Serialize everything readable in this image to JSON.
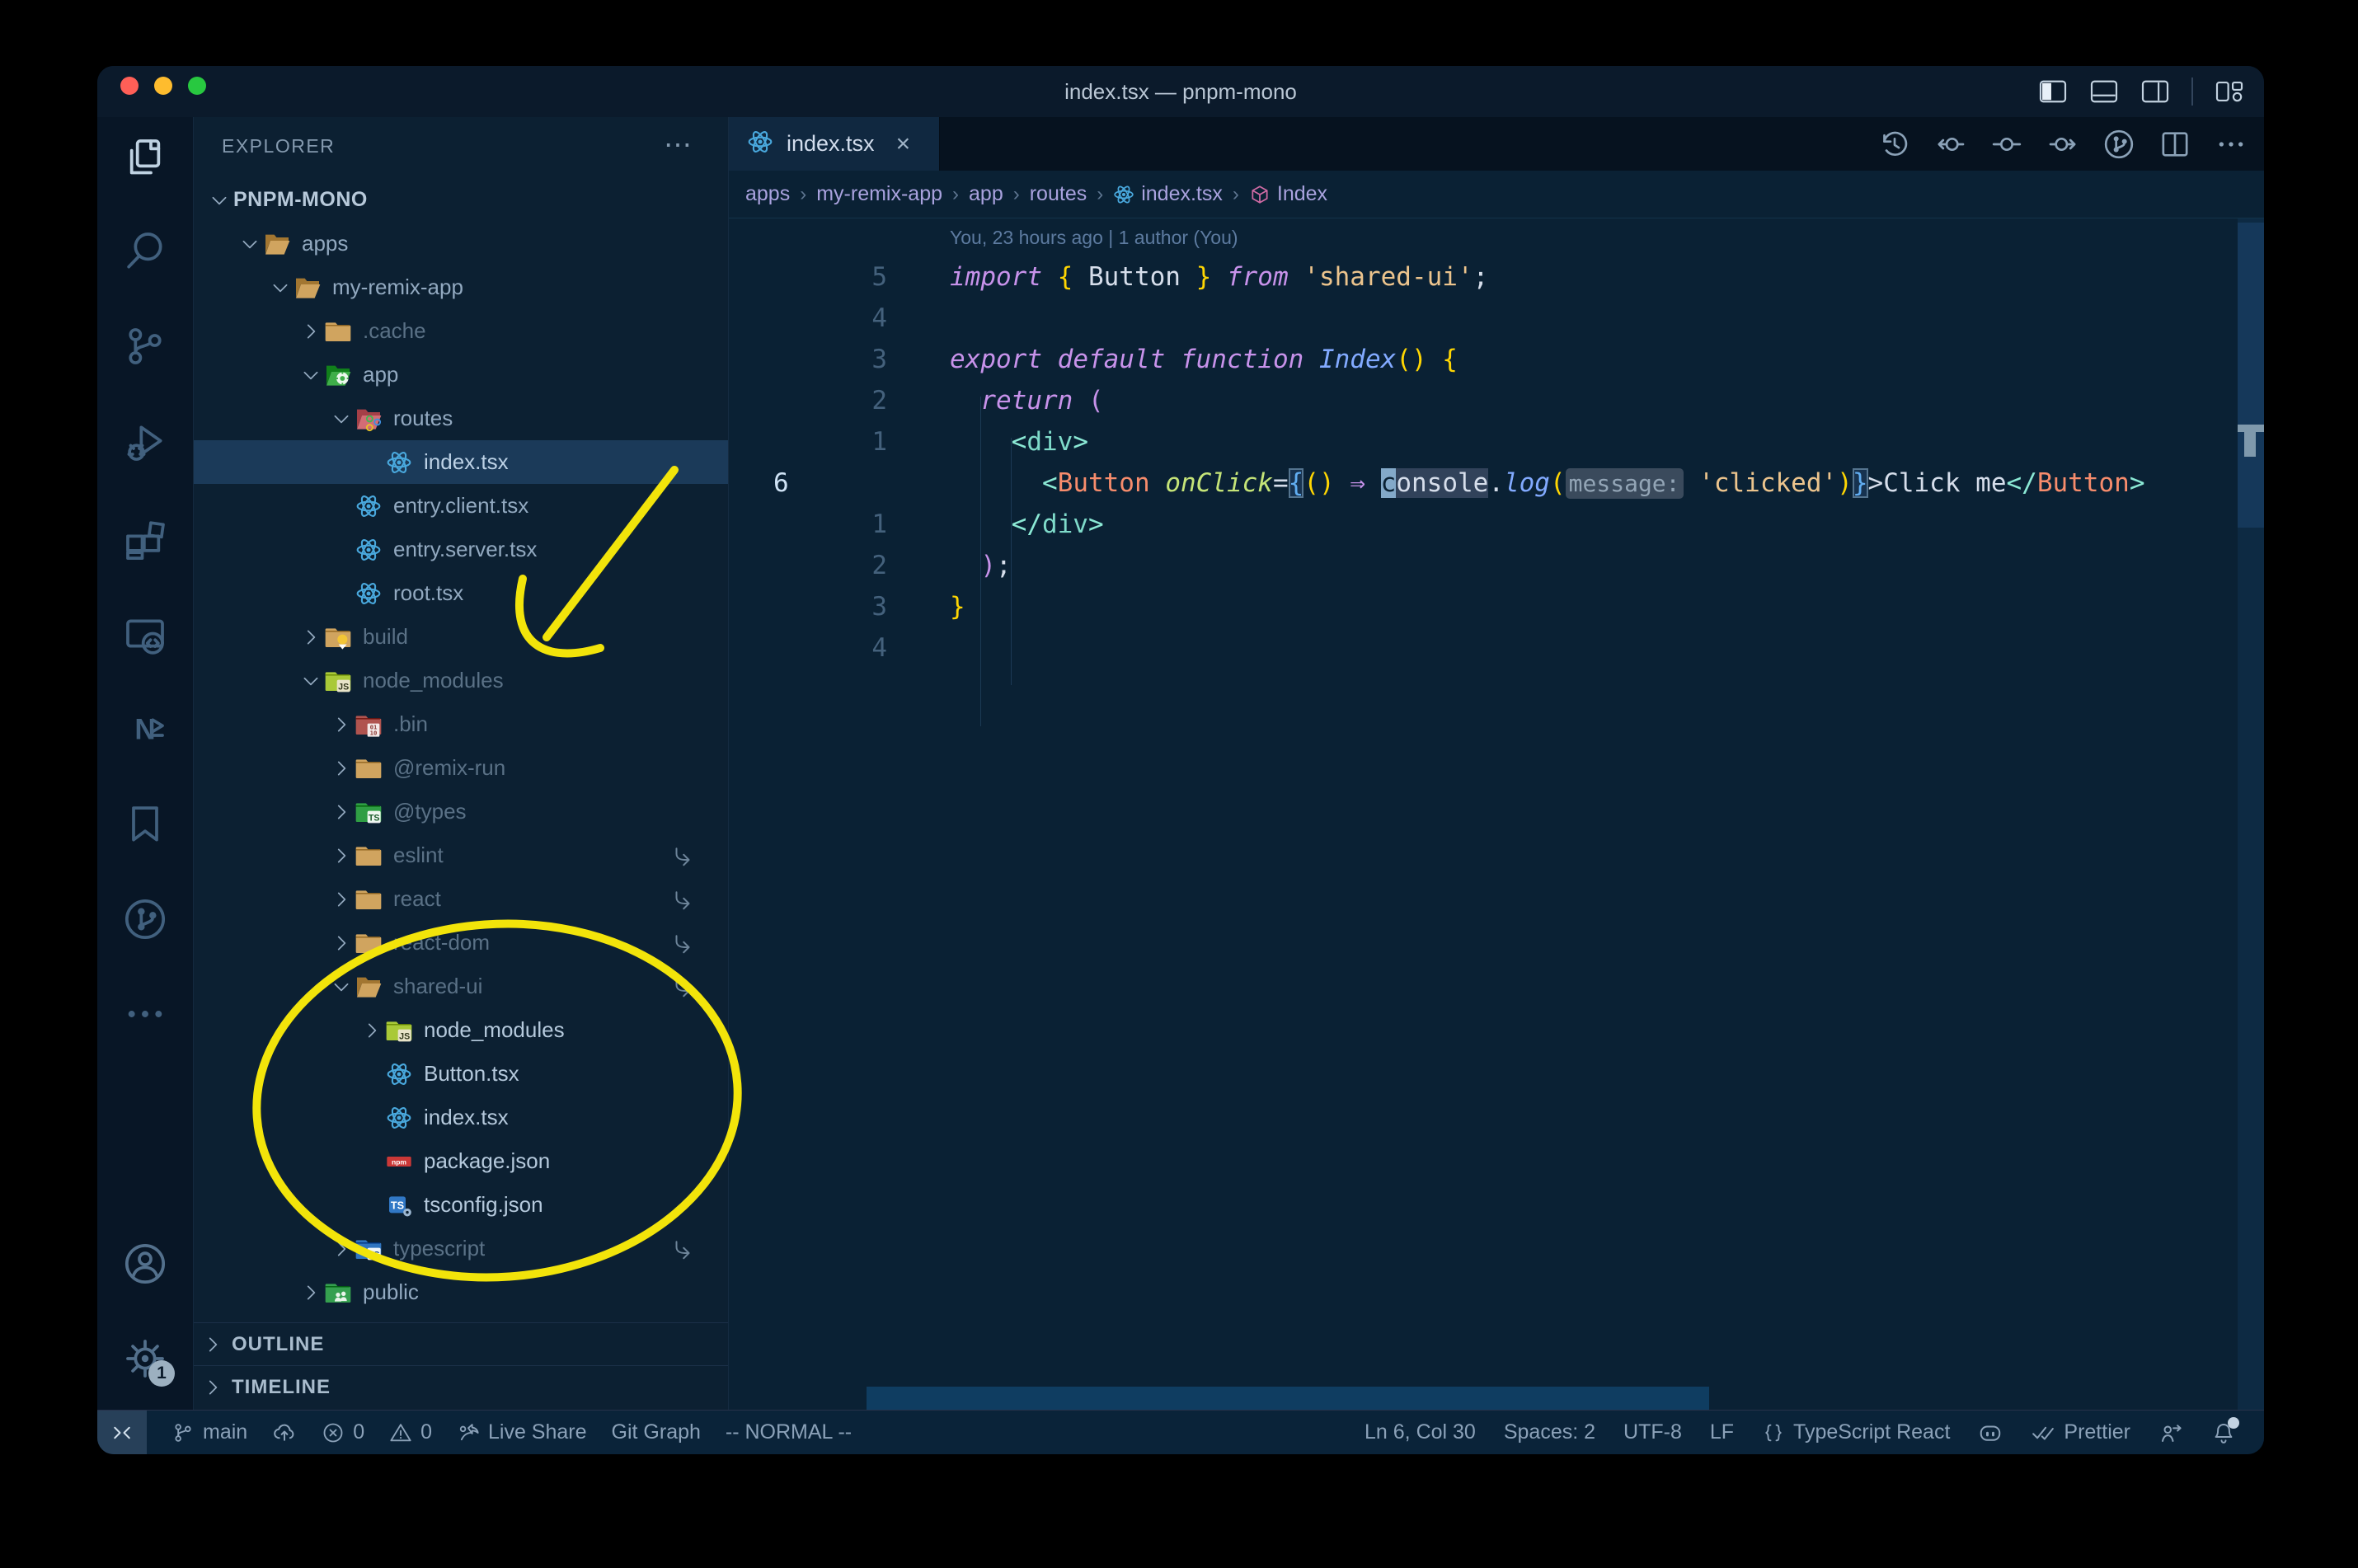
{
  "palette": {
    "annotation_yellow": "#f2e40a",
    "traffic_close": "#ff5f57",
    "traffic_min": "#febc2e",
    "traffic_max": "#28c840",
    "react_blue": "#49a8dd",
    "npm_red": "#cb3837",
    "ts_blue": "#3178c6",
    "folder_tan": "#d0a45f",
    "folder_tan_dark": "#b98c48",
    "folder_green": "#3fae49",
    "folder_lime": "#a9c938",
    "folder_red": "#b0544f",
    "folder_routes": "#d26d75",
    "folder_blue": "#2f74c0",
    "symbol_pink": "#d16ba5"
  },
  "titlebar": {
    "title": "index.tsx — pnpm-mono",
    "layout_icons": [
      "toggle-sidebar-icon",
      "toggle-panel-icon",
      "toggle-secondary-sidebar-icon",
      "customize-layout-icon"
    ]
  },
  "activity_bar": {
    "items": [
      {
        "icon": "files",
        "name": "explorer",
        "active": true
      },
      {
        "icon": "search",
        "name": "search"
      },
      {
        "icon": "source-control",
        "name": "source-control"
      },
      {
        "icon": "run-debug",
        "name": "run-and-debug"
      },
      {
        "icon": "extensions",
        "name": "extensions"
      },
      {
        "icon": "remote-explorer",
        "name": "remote-explorer"
      },
      {
        "icon": "nx-console",
        "name": "nx-console"
      },
      {
        "icon": "bookmarks",
        "name": "bookmarks"
      },
      {
        "icon": "git-graph",
        "name": "git-graph"
      },
      {
        "icon": "more",
        "name": "additional-views"
      }
    ],
    "bottom_items": [
      {
        "icon": "account",
        "name": "accounts"
      },
      {
        "icon": "gear",
        "name": "settings",
        "badge": "1"
      }
    ]
  },
  "sidebar": {
    "header": "EXPLORER",
    "header_more": "⋯",
    "tree": [
      {
        "label": "PNPM-MONO",
        "level": 0,
        "chevron": "open",
        "icon": null,
        "root": true
      },
      {
        "label": "apps",
        "level": 1,
        "chevron": "open",
        "icon": "folder-open"
      },
      {
        "label": "my-remix-app",
        "level": 2,
        "chevron": "open",
        "icon": "folder-open"
      },
      {
        "label": ".cache",
        "level": 3,
        "chevron": "closed",
        "icon": "folder",
        "dim": true
      },
      {
        "label": "app",
        "level": 3,
        "chevron": "open",
        "icon": "folder-app"
      },
      {
        "label": "routes",
        "level": 4,
        "chevron": "open",
        "icon": "folder-routes"
      },
      {
        "label": "index.tsx",
        "level": 5,
        "chevron": null,
        "icon": "react",
        "selected": true
      },
      {
        "label": "entry.client.tsx",
        "level": 4,
        "chevron": null,
        "icon": "react"
      },
      {
        "label": "entry.server.tsx",
        "level": 4,
        "chevron": null,
        "icon": "react"
      },
      {
        "label": "root.tsx",
        "level": 4,
        "chevron": null,
        "icon": "react"
      },
      {
        "label": "build",
        "level": 3,
        "chevron": "closed",
        "icon": "folder-build",
        "dim": true
      },
      {
        "label": "node_modules",
        "level": 3,
        "chevron": "open",
        "icon": "folder-nm",
        "dim": true
      },
      {
        "label": ".bin",
        "level": 4,
        "chevron": "closed",
        "icon": "folder-bin",
        "dim": true
      },
      {
        "label": "@remix-run",
        "level": 4,
        "chevron": "closed",
        "icon": "folder",
        "dim": true
      },
      {
        "label": "@types",
        "level": 4,
        "chevron": "closed",
        "icon": "folder-types",
        "dim": true
      },
      {
        "label": "eslint",
        "level": 4,
        "chevron": "closed",
        "icon": "folder",
        "dim": true,
        "symlink": true
      },
      {
        "label": "react",
        "level": 4,
        "chevron": "closed",
        "icon": "folder",
        "dim": true,
        "symlink": true
      },
      {
        "label": "react-dom",
        "level": 4,
        "chevron": "closed",
        "icon": "folder",
        "dim": true,
        "symlink": true
      },
      {
        "label": "shared-ui",
        "level": 4,
        "chevron": "open",
        "icon": "folder-open",
        "dim": true,
        "symlink": true
      },
      {
        "label": "node_modules",
        "level": 5,
        "chevron": "closed",
        "icon": "folder-nm",
        "bright": true
      },
      {
        "label": "Button.tsx",
        "level": 5,
        "chevron": null,
        "icon": "react",
        "bright": true
      },
      {
        "label": "index.tsx",
        "level": 5,
        "chevron": null,
        "icon": "react",
        "bright": true
      },
      {
        "label": "package.json",
        "level": 5,
        "chevron": null,
        "icon": "npm",
        "bright": true
      },
      {
        "label": "tsconfig.json",
        "level": 5,
        "chevron": null,
        "icon": "tsconfig",
        "bright": true
      },
      {
        "label": "typescript",
        "level": 4,
        "chevron": "closed",
        "icon": "folder-ts",
        "dim": true,
        "symlink": true
      },
      {
        "label": "public",
        "level": 3,
        "chevron": "closed",
        "icon": "folder-public"
      }
    ],
    "sections": [
      {
        "label": "OUTLINE"
      },
      {
        "label": "TIMELINE"
      }
    ]
  },
  "editor": {
    "tab": {
      "label": "index.tsx",
      "icon": "react",
      "close": "×"
    },
    "actions": [
      "timeline-history-icon",
      "navigate-back-icon",
      "commit-icon",
      "navigate-forward-icon",
      "git-graph-icon",
      "split-editor-icon",
      "more-actions-icon"
    ],
    "breadcrumbs": [
      {
        "label": "apps"
      },
      {
        "label": "my-remix-app"
      },
      {
        "label": "app"
      },
      {
        "label": "routes"
      },
      {
        "label": "index.tsx",
        "icon": "react"
      },
      {
        "label": "Index",
        "icon": "symbol-module"
      }
    ],
    "codelens": "You, 23 hours ago | 1 author (You)",
    "lines": [
      {
        "num": "5",
        "tokens": [
          {
            "t": "import ",
            "s": "kw"
          },
          {
            "t": "{ ",
            "s": "brk"
          },
          {
            "t": "Button",
            "s": "pln"
          },
          {
            "t": " }",
            "s": "brk"
          },
          {
            "t": " ",
            "s": "pln"
          },
          {
            "t": "from",
            "s": "kw"
          },
          {
            "t": " ",
            "s": "pln"
          },
          {
            "t": "'shared-ui'",
            "s": "str"
          },
          {
            "t": ";",
            "s": "pln"
          }
        ]
      },
      {
        "num": "4",
        "tokens": []
      },
      {
        "num": "3",
        "tokens": [
          {
            "t": "export",
            "s": "kw"
          },
          {
            "t": " ",
            "s": "pln"
          },
          {
            "t": "default",
            "s": "kw"
          },
          {
            "t": " ",
            "s": "pln"
          },
          {
            "t": "function",
            "s": "kw"
          },
          {
            "t": " ",
            "s": "pln"
          },
          {
            "t": "Index",
            "s": "fn"
          },
          {
            "t": "()",
            "s": "brk"
          },
          {
            "t": " ",
            "s": "pln"
          },
          {
            "t": "{",
            "s": "brk"
          }
        ]
      },
      {
        "num": "2",
        "tokens": [
          {
            "t": "  ",
            "s": "pln"
          },
          {
            "t": "return",
            "s": "kw"
          },
          {
            "t": " ",
            "s": "pln"
          },
          {
            "t": "(",
            "s": "mag"
          }
        ]
      },
      {
        "num": "1",
        "tokens": [
          {
            "t": "    ",
            "s": "pln"
          },
          {
            "t": "<",
            "s": "tagb"
          },
          {
            "t": "div",
            "s": "tag"
          },
          {
            "t": ">",
            "s": "tagb"
          }
        ]
      },
      {
        "num": "6",
        "current": true,
        "tokens": [
          {
            "t": "      ",
            "s": "pln"
          },
          {
            "t": "<",
            "s": "tagb"
          },
          {
            "t": "Button",
            "s": "comp"
          },
          {
            "t": " ",
            "s": "pln"
          },
          {
            "t": "onClick",
            "s": "attr"
          },
          {
            "t": "=",
            "s": "pln"
          },
          {
            "t": "{",
            "s": "bm"
          },
          {
            "t": "()",
            "s": "brk"
          },
          {
            "t": " ",
            "s": "pln"
          },
          {
            "t": "⇒",
            "s": "kwop"
          },
          {
            "t": " ",
            "s": "pln"
          },
          {
            "t": "c",
            "s": "cur"
          },
          {
            "t": "onsole",
            "s": "hlw"
          },
          {
            "t": ".",
            "s": "pln"
          },
          {
            "t": "log",
            "s": "fn"
          },
          {
            "t": "(",
            "s": "brk"
          },
          {
            "t": "message:",
            "s": "hint"
          },
          {
            "t": " ",
            "s": "pln"
          },
          {
            "t": "'clicked'",
            "s": "str"
          },
          {
            "t": ")",
            "s": "brk"
          },
          {
            "t": "}",
            "s": "bm"
          },
          {
            "t": ">",
            "s": "pln"
          },
          {
            "t": "Click me",
            "s": "pln"
          },
          {
            "t": "</",
            "s": "tagb"
          },
          {
            "t": "Button",
            "s": "comp"
          },
          {
            "t": ">",
            "s": "tagb"
          }
        ]
      },
      {
        "num": "1",
        "tokens": [
          {
            "t": "    ",
            "s": "pln"
          },
          {
            "t": "</",
            "s": "tagb"
          },
          {
            "t": "div",
            "s": "tag"
          },
          {
            "t": ">",
            "s": "tagb"
          }
        ]
      },
      {
        "num": "2",
        "tokens": [
          {
            "t": "  ",
            "s": "pln"
          },
          {
            "t": ")",
            "s": "mag"
          },
          {
            "t": ";",
            "s": "pln"
          }
        ]
      },
      {
        "num": "3",
        "tokens": [
          {
            "t": "}",
            "s": "brk"
          }
        ]
      },
      {
        "num": "4",
        "tokens": []
      }
    ]
  },
  "status_bar": {
    "left": [
      {
        "icon": "remote",
        "name": "remote-indicator",
        "remote_block": true
      },
      {
        "icon": "branch",
        "label": "main",
        "name": "git-branch"
      },
      {
        "icon": "cloud-upload",
        "name": "publish-changes"
      },
      {
        "icon": "error",
        "label": "0",
        "name": "errors"
      },
      {
        "icon": "warning",
        "label": "0",
        "name": "warnings"
      },
      {
        "icon": "liveshare",
        "label": "Live Share",
        "name": "live-share"
      },
      {
        "label": "Git Graph",
        "name": "git-graph"
      },
      {
        "label": "-- NORMAL --",
        "name": "vim-mode"
      }
    ],
    "right": [
      {
        "label": "Ln 6, Col 30",
        "name": "cursor-position"
      },
      {
        "label": "Spaces: 2",
        "name": "indentation"
      },
      {
        "label": "UTF-8",
        "name": "encoding"
      },
      {
        "label": "LF",
        "name": "eol"
      },
      {
        "icon": "braces",
        "label": "TypeScript React",
        "name": "language-mode"
      },
      {
        "icon": "copilot",
        "name": "copilot"
      },
      {
        "icon": "doublecheck",
        "label": "Prettier",
        "name": "prettier"
      },
      {
        "icon": "person-arrow",
        "name": "feedback"
      },
      {
        "icon": "bell-dot",
        "name": "notifications"
      }
    ]
  },
  "annotations": {
    "arrow_target": "node_modules",
    "ellipse_target": "shared-ui package contents",
    "color": "#f2e40a"
  }
}
